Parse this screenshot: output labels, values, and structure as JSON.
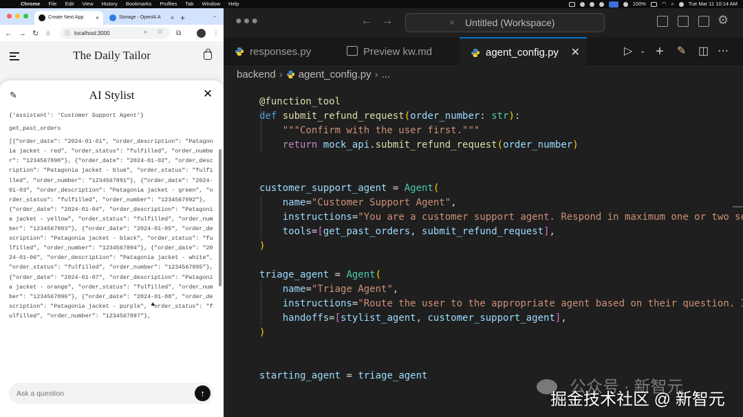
{
  "menubar": {
    "app": "Chrome",
    "menus": [
      "File",
      "Edit",
      "View",
      "History",
      "Bookmarks",
      "Profiles",
      "Tab",
      "Window",
      "Help"
    ],
    "battery": "100%",
    "clock": "Tue Mar 11  10:14 AM"
  },
  "browser": {
    "tabs": [
      {
        "title": "Create Next App"
      },
      {
        "title": "Storage - OpenAI A"
      }
    ],
    "url": "localhost:3000"
  },
  "site": {
    "title": "The Daily Tailor"
  },
  "chat": {
    "title": "AI Stylist",
    "messages": [
      "{'assistant': 'Customer Support Agent'}",
      "get_past_orders",
      "[{\"order_date\": \"2024-01-01\", \"order_description\": \"Patagonia jacket - red\", \"order_status\": \"fulfilled\", \"order_number\": \"1234567890\"}, {\"order_date\": \"2024-01-02\", \"order_description\": \"Patagonia jacket - blue\", \"order_status\": \"fulfilled\", \"order_number\": \"1234567891\"}, {\"order_date\": \"2024-01-03\", \"order_description\": \"Patagonia jacket - green\", \"order_status\": \"fulfilled\", \"order_number\": \"1234567892\"}, {\"order_date\": \"2024-01-04\", \"order_description\": \"Patagonia jacket - yellow\", \"order_status\": \"fulfilled\", \"order_number\": \"1234567893\"}, {\"order_date\": \"2024-01-05\", \"order_description\": \"Patagonia jacket - black\", \"order_status\": \"fulfilled\", \"order_number\": \"1234567894\"}, {\"order_date\": \"2024-01-06\", \"order_description\": \"Patagonia jacket - white\", \"order_status\": \"fulfilled\", \"order_number\": \"1234567895\"}, {\"order_date\": \"2024-01-07\", \"order_description\": \"Patagonia jacket - orange\", \"order_status\": \"fulfilled\", \"order_number\": \"1234567896\"}, {\"order_date\": \"2024-01-08\", \"order_description\": \"Patagonia jacket - purple\", \"order_status\": \"fulfilled\", \"order_number\": \"1234567897\"},"
    ],
    "input_placeholder": "Ask a question"
  },
  "vscode": {
    "command_center": "Untitled (Workspace)",
    "tabs": [
      {
        "label": "responses.py"
      },
      {
        "label": "Preview kw.md"
      },
      {
        "label": "agent_config.py"
      }
    ],
    "breadcrumbs": [
      "backend",
      "agent_config.py",
      "..."
    ],
    "code": {
      "decorator": "@function_tool",
      "def_kw": "def",
      "func_name": "submit_refund_request",
      "param": "order_number",
      "param_type": "str",
      "docstring": "\"\"\"Confirm with the user first.\"\"\"",
      "return_kw": "return",
      "return_obj": "mock_api",
      "return_call": "submit_refund_request",
      "support_var": "customer_support_agent",
      "agent_class": "Agent",
      "kw_name": "name",
      "kw_instructions": "instructions",
      "kw_tools": "tools",
      "kw_handoffs": "handoffs",
      "support_name": "\"Customer Support Agent\"",
      "support_instructions": "\"You are a customer support agent. Respond in maximum one or two se",
      "tool_1": "get_past_orders",
      "tool_2": "submit_refund_request",
      "triage_var": "triage_agent",
      "triage_name": "\"Triage Agent\"",
      "triage_instructions": "\"Route the user to the appropriate agent based on their question. I",
      "handoff_1": "stylist_agent",
      "handoff_2": "customer_support_agent",
      "start_var": "starting_agent",
      "start_val": "triage_agent"
    }
  },
  "watermark": {
    "line1": "公众号 · 新智元",
    "line2": "掘金技术社区 @ 新智元"
  }
}
